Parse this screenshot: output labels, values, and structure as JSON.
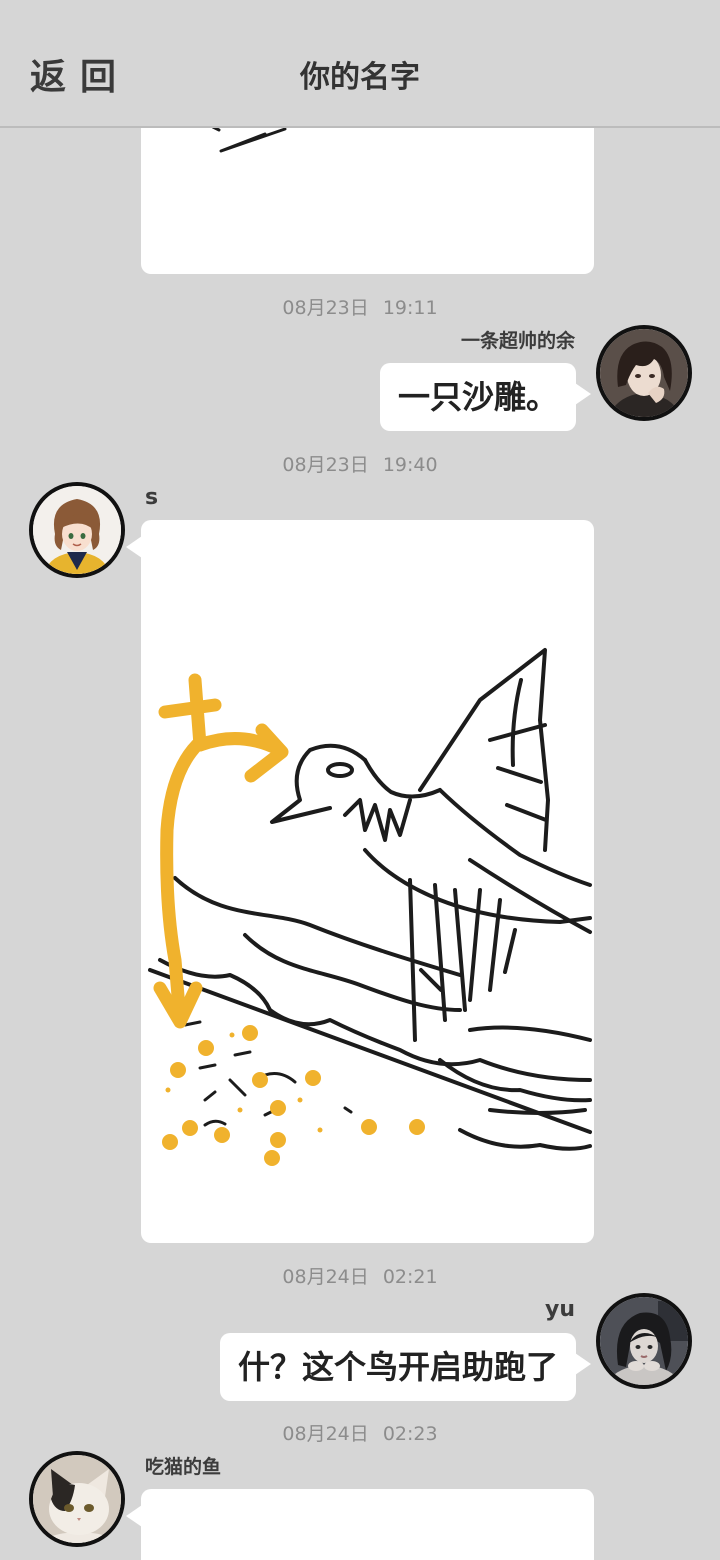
{
  "header": {
    "back_label": "返回",
    "title": "你的名字"
  },
  "messages": [
    {
      "timestamp": "08月23日 19:11",
      "sender": "一条超帅的余",
      "text": "一只沙雕。",
      "avatar_icon": "avatar-anime-boy-icon"
    },
    {
      "timestamp": "08月23日 19:40",
      "sender": "s",
      "avatar_icon": "avatar-anime-girl-icon"
    },
    {
      "timestamp": "08月24日 02:21",
      "sender": "yu",
      "text": "什？这个鸟开启助跑了",
      "avatar_icon": "avatar-dark-hair-girl-icon"
    },
    {
      "timestamp": "08月24日 02:23",
      "sender": "吃猫的鱼",
      "avatar_icon": "avatar-cat-icon"
    }
  ],
  "colors": {
    "background": "#d6d6d6",
    "bubble": "#ffffff",
    "text": "#222222",
    "timestamp": "#8c8c8c",
    "sketch_ink": "#1c1c1c",
    "sketch_accent": "#f0b22d"
  }
}
